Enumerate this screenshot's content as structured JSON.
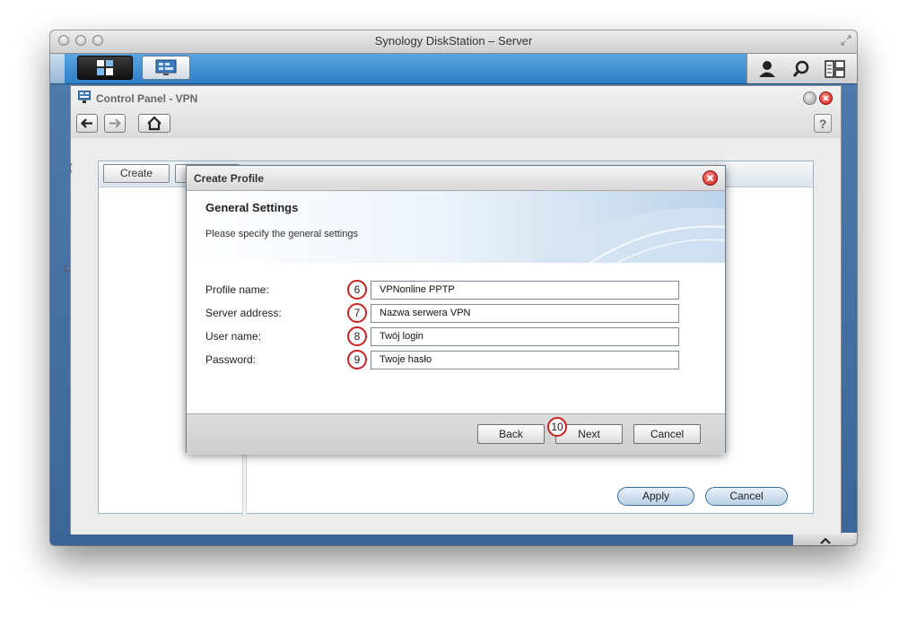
{
  "window": {
    "title": "Synology DiskStation – Server"
  },
  "control_panel": {
    "title": "Control Panel - VPN"
  },
  "toolbar": {
    "create_label": "Create"
  },
  "help_label": "?",
  "dialog": {
    "title": "Create Profile",
    "heading": "General Settings",
    "subtitle": "Please specify the general settings",
    "fields": [
      {
        "label": "Profile name:",
        "value": "VPNonline PPTP",
        "step": "6"
      },
      {
        "label": "Server address:",
        "value": "Nazwa serwera VPN",
        "step": "7"
      },
      {
        "label": "User name:",
        "value": "Twój login",
        "step": "8"
      },
      {
        "label": "Password:",
        "value": "Twoje hasło",
        "step": "9"
      }
    ],
    "next_step": "10",
    "buttons": {
      "back": "Back",
      "next": "Next",
      "cancel": "Cancel"
    }
  },
  "panel_buttons": {
    "apply": "Apply",
    "cancel": "Cancel"
  },
  "side_letters": {
    "left_top": "(",
    "left_mid": "C"
  },
  "colors": {
    "taskbar": "#3a8bd0",
    "desktop": "#4670a0",
    "badge_ring": "#c92222",
    "close_red": "#d11a1a"
  }
}
